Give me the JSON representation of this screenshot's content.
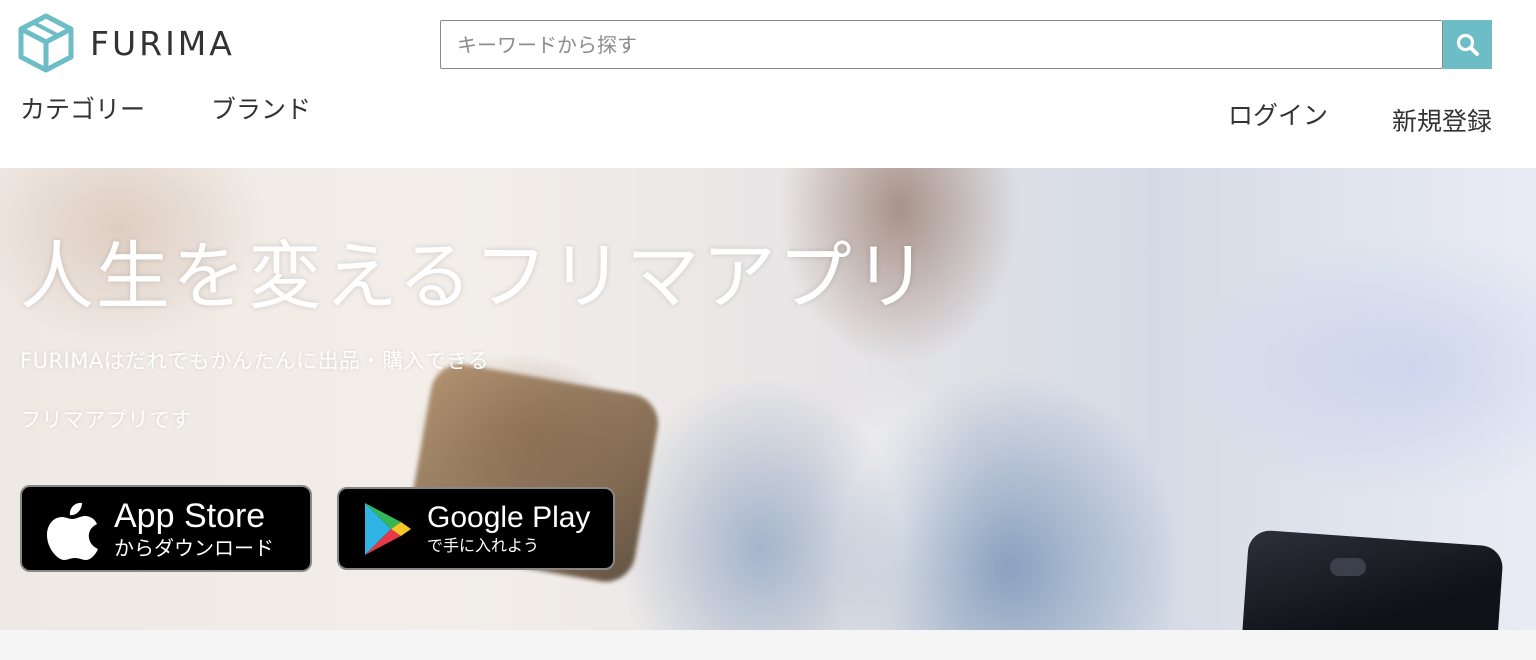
{
  "header": {
    "logo_text": "FURIMA",
    "brand_color": "#6dbdc6",
    "search": {
      "placeholder": "キーワードから探す",
      "value": "",
      "button_icon": "search-icon"
    },
    "nav_left": [
      {
        "label": "カテゴリー"
      },
      {
        "label": "ブランド"
      }
    ],
    "nav_right": {
      "login": "ログイン",
      "signup": "新規登録"
    }
  },
  "hero": {
    "title": "人生を変えるフリマアプリ",
    "subtitle_line1": "FURIMAはだれでもかんたんに出品・購入できる",
    "subtitle_line2": "フリマアプリです",
    "badges": {
      "app_store": {
        "main": "App Store",
        "sub": "からダウンロード",
        "icon": "apple-icon"
      },
      "google_play": {
        "main": "Google Play",
        "sub": "で手に入れよう",
        "icon": "google-play-icon"
      }
    }
  }
}
